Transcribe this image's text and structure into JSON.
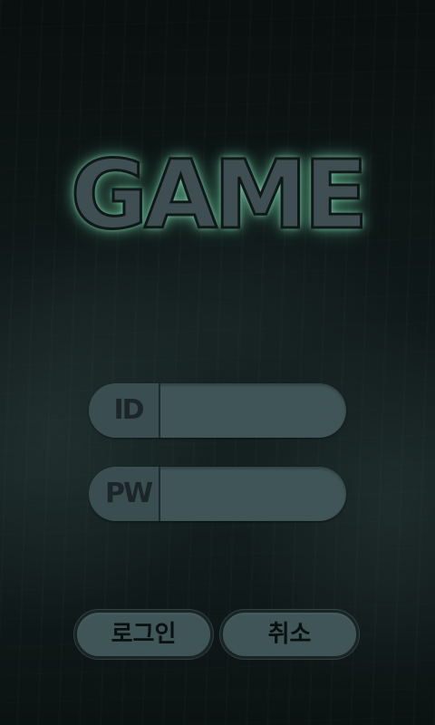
{
  "title": "GAME",
  "form": {
    "id_label": "ID",
    "id_value": "",
    "pw_label": "PW",
    "pw_value": ""
  },
  "buttons": {
    "login": "로그인",
    "cancel": "취소"
  },
  "colors": {
    "background": "#0c1313",
    "field": "#3f5557",
    "title_glow": "#8fdcb4"
  }
}
